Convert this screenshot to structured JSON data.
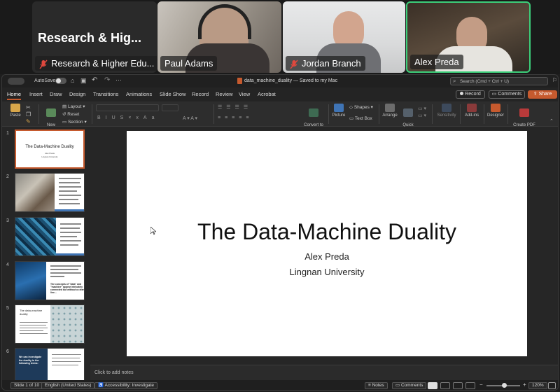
{
  "meeting": {
    "tiles": [
      {
        "name": "Research & Higher Edu...",
        "muted": true
      },
      {
        "name": "Paul Adams",
        "muted": false
      },
      {
        "name": "Jordan Branch",
        "muted": true
      },
      {
        "name": "Alex Preda",
        "muted": false,
        "active_speaker": true
      }
    ],
    "featured_title": "Research & Hig..."
  },
  "ppt": {
    "autosave_label": "AutoSave",
    "autosave_state": "off",
    "doc_title": "data_machine_duality — Saved to my Mac",
    "search_placeholder": "Search (Cmd + Ctrl + U)",
    "tabs": [
      "Home",
      "Insert",
      "Draw",
      "Design",
      "Transitions",
      "Animations",
      "Slide Show",
      "Record",
      "Review",
      "View",
      "Acrobat"
    ],
    "active_tab": "Home",
    "record_label": "Record",
    "comments_label": "Comments",
    "share_label": "Share",
    "ribbon": {
      "paste": "Paste",
      "new_slide": "New\nSlide",
      "layout": "Layout",
      "reset": "Reset",
      "section": "Section",
      "convert_smartart": "Convert to\nSmartArt",
      "picture": "Picture",
      "shapes": "Shapes",
      "text_box": "Text Box",
      "arrange": "Arrange",
      "quick_styles": "Quick\nStyles",
      "sensitivity": "Sensitivity",
      "add_ins": "Add-ins",
      "designer": "Designer",
      "create_pdf": "Create PDF\nand share link"
    },
    "thumbnails": [
      {
        "num": "1",
        "title": "The Data-Machine Duality",
        "sub1": "Alex Preda",
        "sub2": "Lingnan University",
        "kind": "title"
      },
      {
        "num": "2",
        "kind": "image-left"
      },
      {
        "num": "3",
        "kind": "image-left-blue"
      },
      {
        "num": "4",
        "kind": "image-top",
        "caption": "The concepts of \"data\" and \"machine\" appear intricately connected but without a clear line..."
      },
      {
        "num": "5",
        "kind": "text-image",
        "title": "The data-machine duality"
      },
      {
        "num": "6",
        "kind": "dark-left",
        "title": "We can investigate the duality in the following terms:"
      }
    ],
    "slide": {
      "title": "The Data-Machine Duality",
      "author": "Alex Preda",
      "affiliation": "Lingnan University"
    },
    "notes_placeholder": "Click to add notes",
    "status": {
      "slide_counter": "Slide 1 of 10",
      "language": "English (United States)",
      "accessibility": "Accessibility: Investigate",
      "notes": "Notes",
      "comments": "Comments",
      "zoom": "120%"
    }
  },
  "colors": {
    "accent": "#c65a2e",
    "active_speaker_border": "#3ccf7a",
    "muted_icon": "#e0483e"
  }
}
